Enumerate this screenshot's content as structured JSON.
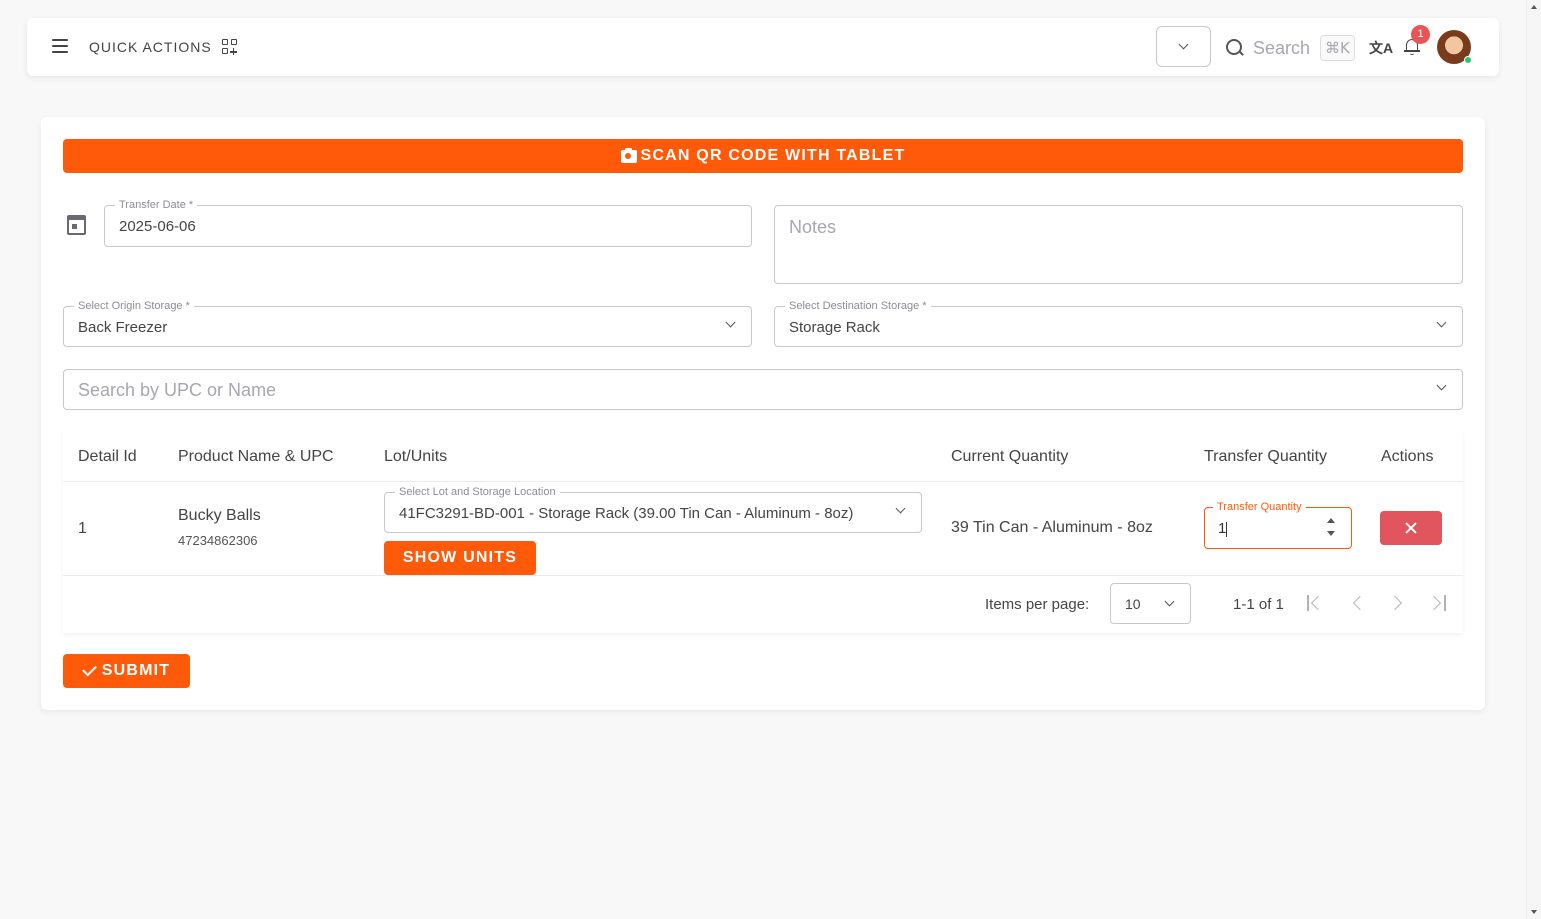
{
  "navbar": {
    "quick_actions_label": "QUICK ACTIONS",
    "search_label": "Search",
    "search_shortcut": "⌘K",
    "translate_glyph": "文A",
    "notification_count": "1"
  },
  "form": {
    "scan_button_label": "SCAN QR CODE WITH TABLET",
    "transfer_date": {
      "label": "Transfer Date *",
      "value": "2025-06-06"
    },
    "notes": {
      "placeholder": "Notes"
    },
    "origin_storage": {
      "label": "Select Origin Storage *",
      "value": "Back Freezer"
    },
    "destination_storage": {
      "label": "Select Destination Storage *",
      "value": "Storage Rack"
    },
    "product_search": {
      "placeholder": "Search by UPC or Name"
    },
    "submit_label": "SUBMIT"
  },
  "table": {
    "headers": {
      "detail_id": "Detail Id",
      "product": "Product Name & UPC",
      "lot_units": "Lot/Units",
      "current_qty": "Current Quantity",
      "transfer_qty": "Transfer Quantity",
      "actions": "Actions"
    },
    "rows": [
      {
        "detail_id": "1",
        "product_name": "Bucky Balls",
        "upc": "47234862306",
        "lot_label": "Select Lot and Storage Location",
        "lot_value": "41FC3291-BD-001 - Storage Rack (39.00 Tin Can - Aluminum - 8oz)",
        "show_units_label": "SHOW UNITS",
        "current_quantity": "39 Tin Can - Aluminum - 8oz",
        "transfer_qty_label": "Transfer Quantity",
        "transfer_qty_value": "1"
      }
    ],
    "pagination": {
      "items_per_page_label": "Items per page:",
      "items_per_page_value": "10",
      "range": "1-1 of 1"
    }
  },
  "colors": {
    "accent": "#ff5a0a",
    "danger": "#e0555e",
    "badge": "#ea5455",
    "online": "#28c76f"
  }
}
